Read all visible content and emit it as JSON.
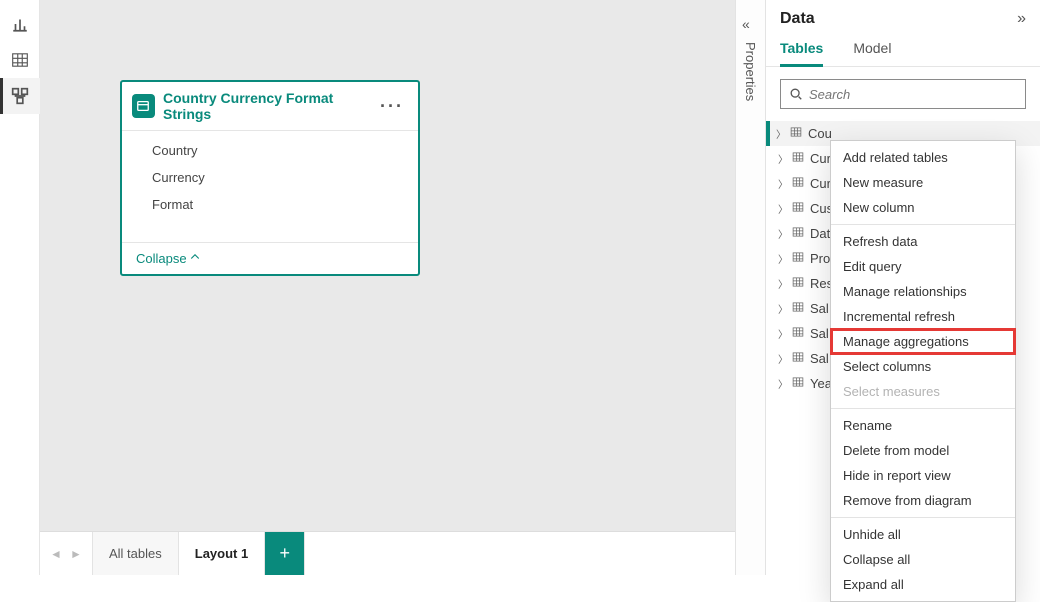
{
  "rail": {
    "items": [
      {
        "name": "report-view-icon"
      },
      {
        "name": "data-view-icon"
      },
      {
        "name": "model-view-icon"
      }
    ],
    "active_index": 2
  },
  "card": {
    "title": "Country Currency Format Strings",
    "fields": [
      "Country",
      "Currency",
      "Format"
    ],
    "collapse_label": "Collapse"
  },
  "tabs": {
    "all_label": "All tables",
    "layout_label": "Layout 1"
  },
  "properties": {
    "label": "Properties"
  },
  "dataPane": {
    "title": "Data",
    "tab_tables": "Tables",
    "tab_model": "Model",
    "search_placeholder": "Search",
    "tables": [
      "Cou",
      "Cur",
      "Cur",
      "Cus",
      "Dat",
      "Pro",
      "Res",
      "Sal",
      "Sal",
      "Sal",
      "Yea"
    ],
    "selected_index": 0
  },
  "context_menu": {
    "items": [
      {
        "label": "Add related tables"
      },
      {
        "label": "New measure"
      },
      {
        "label": "New column"
      },
      {
        "label": "Refresh data"
      },
      {
        "label": "Edit query"
      },
      {
        "label": "Manage relationships"
      },
      {
        "label": "Incremental refresh"
      },
      {
        "label": "Manage aggregations",
        "highlight": true
      },
      {
        "label": "Select columns"
      },
      {
        "label": "Select measures",
        "disabled": true
      },
      {
        "label": "Rename"
      },
      {
        "label": "Delete from model"
      },
      {
        "label": "Hide in report view"
      },
      {
        "label": "Remove from diagram"
      },
      {
        "label": "Unhide all"
      },
      {
        "label": "Collapse all"
      },
      {
        "label": "Expand all"
      }
    ],
    "separators_after": [
      2,
      9,
      13
    ]
  }
}
